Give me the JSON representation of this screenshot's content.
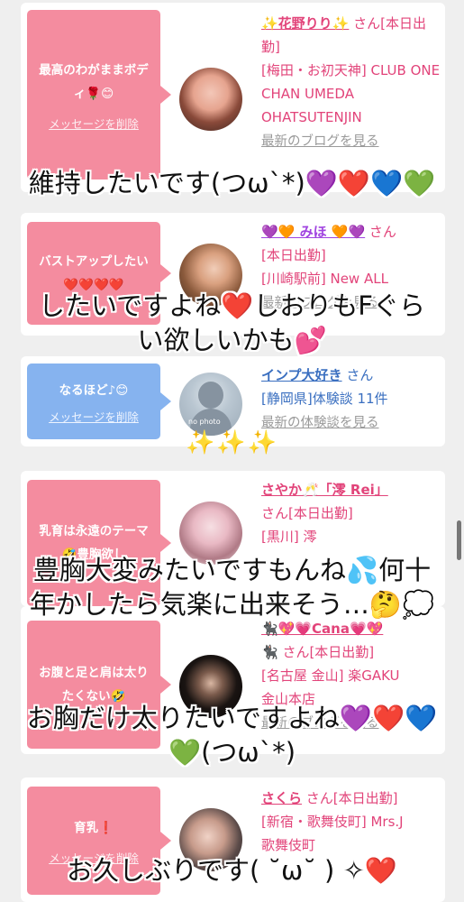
{
  "cards": [
    {
      "bubble": "最高のわがままボディ🌹😊",
      "delete": "メッセージを削除",
      "name": "✨花野りり✨",
      "san": " さん[本日出勤]",
      "lines": [
        "[梅田・お初天神] CLUB ONE CHAN UMEDA OHATSUTENJIN"
      ],
      "link": "最新のブログを見る"
    },
    {
      "bubble": "バストアップしたい❤️❤️❤️❤️",
      "delete": "",
      "name": "💜🧡 みほ 🧡💜",
      "san": " さん",
      "lines": [
        "[本日出勤]",
        "[川崎駅前] New ALL"
      ],
      "link": "最新のブログを見る"
    },
    {
      "bubble": "なるほど♪😊",
      "delete": "メッセージを削除",
      "name": "インプ大好き",
      "san": " さん",
      "lines": [
        "[静岡県]体験談 11件"
      ],
      "link": "最新の体験談を見る",
      "avatar_label": "no photo"
    },
    {
      "bubble": "乳育は永遠のテーマ🤣豊胸欲し",
      "delete": "",
      "name": "さやか🥂「澪 Rei」",
      "san": "さん[本日出勤]",
      "lines": [
        "[黒川] 澪"
      ],
      "link": ""
    },
    {
      "bubble": "お腹と足と肩は太りたくない🤣",
      "delete": "",
      "name": "🐈‍⬛💖💗Cana💗💖",
      "san": "🐈‍⬛ さん[本日出勤]",
      "lines": [
        "[名古屋 金山] 楽GAKU",
        "金山本店"
      ],
      "link": "最新のブログを見る"
    },
    {
      "bubble": "育乳❗️",
      "delete": "メッセージを削除",
      "name": "さくら",
      "san": " さん[本日出勤]",
      "lines": [
        "[新宿・歌舞伎町] Mrs.J",
        "歌舞伎町"
      ],
      "link": ""
    }
  ],
  "overlays": {
    "o1": "維持したいです(つω`*)💜❤️💙💚",
    "o2a": "したいですよね❤️しおりもFぐら",
    "o2b": "い欲しいかも💕",
    "o3a": "豊胸大変みたいですもんね💦何十",
    "o3b": "年かしたら気楽に出来そう…🤔💭",
    "o4a": "お胸だけ太りたいですよね💜❤️💙",
    "o4b": "💚(つω`*)",
    "o5": "お久しぶりです( ˘ω˘ ) ✧❤️"
  },
  "sparkles": "✨✨✨"
}
